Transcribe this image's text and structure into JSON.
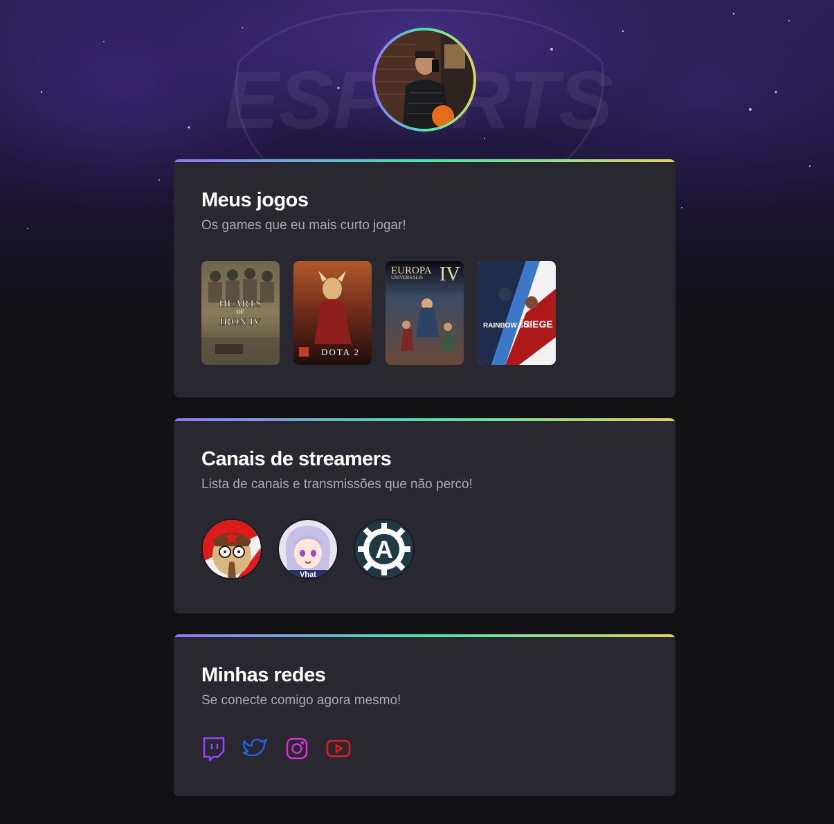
{
  "profile": {
    "avatar_icon": "profile-photo"
  },
  "background": {
    "watermark": "ESPORTS"
  },
  "games_section": {
    "title": "Meus jogos",
    "subtitle": "Os games que eu mais curto jogar!",
    "games": [
      {
        "title_line1": "HEARTS",
        "title_line2": "OF",
        "title_line3": "IRON IV"
      },
      {
        "title_line1": "DOTA 2"
      },
      {
        "title_line1": "EUROPA",
        "title_line2": "UNIVERSALIS",
        "title_line3": "IV"
      },
      {
        "title_line1": "RAINBOW SIX",
        "title_line2": "SIEGE"
      }
    ]
  },
  "streamers_section": {
    "title": "Canais de streamers",
    "subtitle": "Lista de canais e transmissões que não perco!",
    "streamers": [
      {
        "icon": "cartoon-dog-avatar"
      },
      {
        "icon": "anime-girl-avatar"
      },
      {
        "icon": "gear-a-logo-avatar"
      }
    ]
  },
  "socials_section": {
    "title": "Minhas redes",
    "subtitle": "Se conecte comigo agora mesmo!",
    "links": [
      {
        "icon": "twitch-icon",
        "color": "#9146ff"
      },
      {
        "icon": "twitter-icon",
        "color": "#1d64e6"
      },
      {
        "icon": "instagram-icon",
        "color": "#d62fd6"
      },
      {
        "icon": "youtube-icon",
        "color": "#e01b1b"
      }
    ]
  },
  "colors": {
    "background": "#121214",
    "card": "#29272f",
    "gradient": [
      "#9572fc",
      "#43e7ad",
      "#e2d45c"
    ],
    "title": "#ffffff",
    "subtitle": "#a8a8b3"
  }
}
